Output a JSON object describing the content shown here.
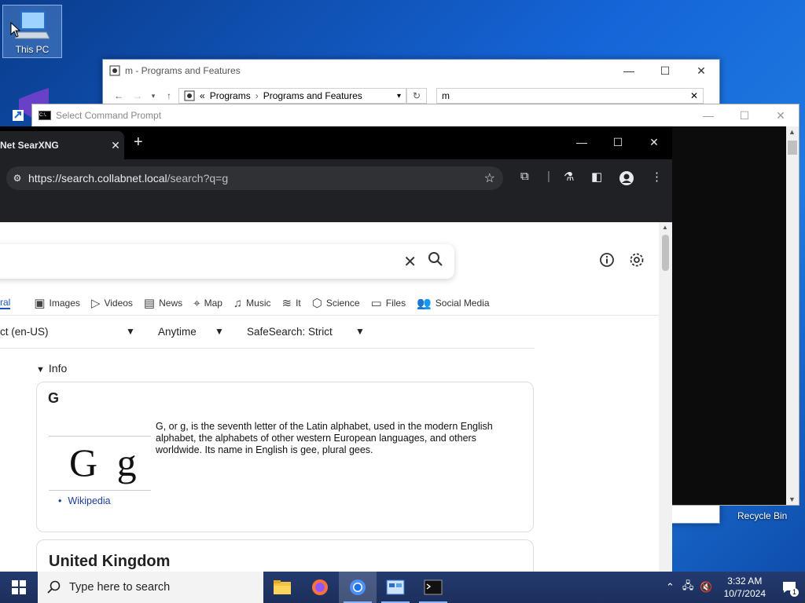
{
  "desktop": {
    "this_pc_label": "This PC",
    "recycle_bin_label": "Recycle Bin"
  },
  "programs_window": {
    "title": "m - Programs and Features",
    "breadcrumb_prefix": "«",
    "crumb1": "Programs",
    "crumb_sep": "›",
    "crumb2": "Programs and Features",
    "search_value": "m",
    "controls": {
      "minimize": "—",
      "maximize": "☐",
      "close": "✕"
    }
  },
  "cmd_window": {
    "title": "Select Command Prompt",
    "icon_text": "C:\\."
  },
  "chrome": {
    "tab_title": "Net SearXNG",
    "tab_close": "✕",
    "new_tab": "+",
    "url_host": "https://search.collabnet.local",
    "url_path": "/search?q=g"
  },
  "page": {
    "categories": [
      {
        "icon": "general-icon",
        "label": "ral"
      },
      {
        "icon": "images-icon",
        "label": "Images"
      },
      {
        "icon": "videos-icon",
        "label": "Videos"
      },
      {
        "icon": "news-icon",
        "label": "News"
      },
      {
        "icon": "map-icon",
        "label": "Map"
      },
      {
        "icon": "music-icon",
        "label": "Music"
      },
      {
        "icon": "it-icon",
        "label": "It"
      },
      {
        "icon": "science-icon",
        "label": "Science"
      },
      {
        "icon": "files-icon",
        "label": "Files"
      },
      {
        "icon": "social-media-icon",
        "label": "Social Media"
      }
    ],
    "filter_language": "ct (en-US)",
    "filter_time": "Anytime",
    "filter_safesearch": "SafeSearch: Strict",
    "info_heading": "Info",
    "infobox": {
      "title": "G",
      "image_text": "G g",
      "description": "G, or g, is the seventh letter of the Latin alphabet, used in the modern English alphabet, the alphabets of other western European languages, and others worldwide. Its name in English is gee, plural gees.",
      "link": "Wikipedia"
    },
    "second_card_title": "United Kingdom"
  },
  "taskbar": {
    "search_placeholder": "Type here to search",
    "time": "3:32 AM",
    "date": "10/7/2024",
    "notification_count": "1"
  }
}
